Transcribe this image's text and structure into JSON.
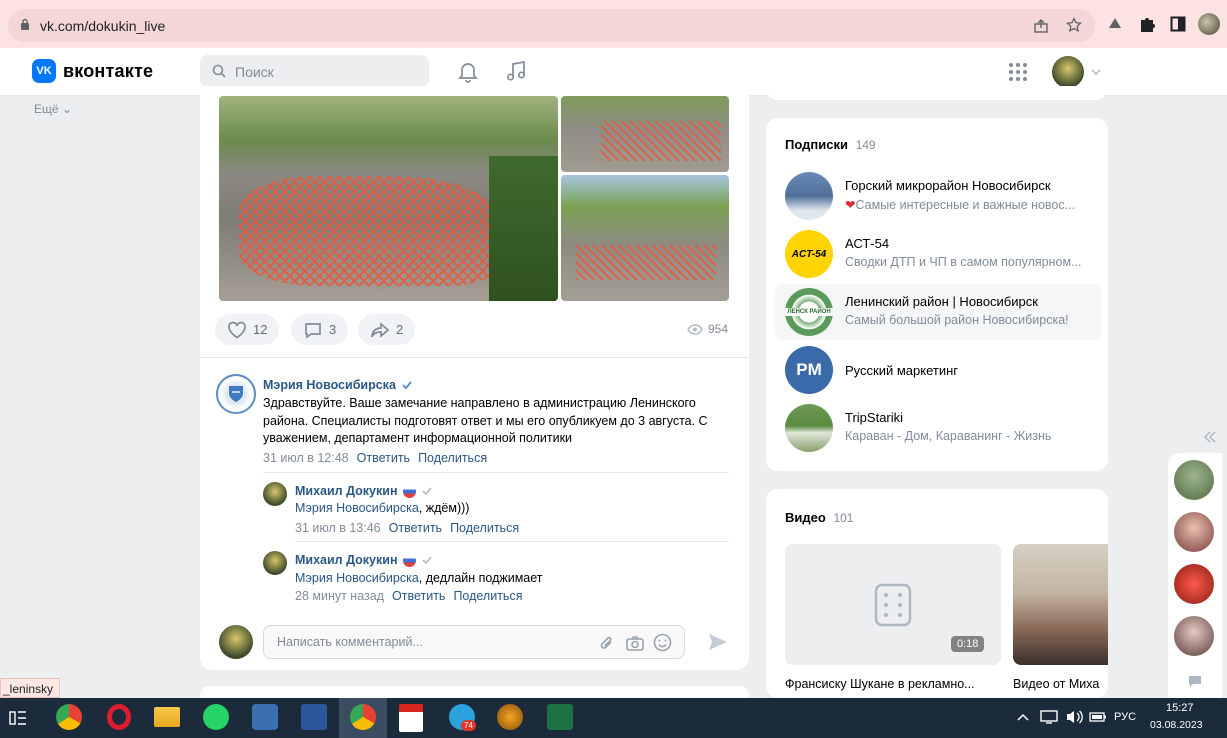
{
  "browser": {
    "url": "vk.com/dokukin_live"
  },
  "header": {
    "logo_text": "вконтакте",
    "search_placeholder": "Поиск"
  },
  "left_menu": {
    "more": "Ещё ⌄"
  },
  "post": {
    "likes": "12",
    "comments": "3",
    "shares": "2",
    "views": "954"
  },
  "comments": [
    {
      "author": "Мэрия Новосибирска",
      "text": "Здравствуйте. Ваше замечание направлено в администрацию Ленинского района. Специалисты подготовят ответ и мы его опубликуем до 3 августа. С уважением, департамент информационной политики",
      "time": "31 июл в 12:48",
      "reply": "Ответить",
      "share": "Поделиться"
    },
    {
      "author": "Михаил Докукин",
      "mention": "Мэрия Новосибирска",
      "text": ", ждём)))",
      "time": "31 июл в 13:46",
      "reply": "Ответить",
      "share": "Поделиться"
    },
    {
      "author": "Михаил Докукин",
      "mention": "Мэрия Новосибирска",
      "text": ", дедлайн поджимает",
      "time": "28 минут назад",
      "reply": "Ответить",
      "share": "Поделиться"
    }
  ],
  "comment_input": {
    "placeholder": "Написать комментарий..."
  },
  "subscriptions": {
    "title": "Подписки",
    "count": "149",
    "items": [
      {
        "name": "Горский микрорайон Новосибирск",
        "desc": "Самые интересные и важные новос..."
      },
      {
        "name": "АСТ-54",
        "desc": "Сводки ДТП и ЧП в самом популярном..."
      },
      {
        "name": "Ленинский район | Новосибирск",
        "desc": "Самый большой район Новосибирска!"
      },
      {
        "name": "Русский маркетинг",
        "desc": ""
      },
      {
        "name": "TripStariki",
        "desc": "Караван - Дом, Караванинг - Жизнь"
      }
    ],
    "avatar_texts": {
      "act": "ACT-54",
      "pm": "PM",
      "lenin": "ЛЕНСК РАЙОН"
    }
  },
  "videos": {
    "title": "Видео",
    "count": "101",
    "items": [
      {
        "title": "Франсиску Шукане в рекламно...",
        "duration": "0:18"
      },
      {
        "title": "Видео от Миха"
      }
    ]
  },
  "status_link": "_leninsky",
  "taskbar": {
    "lang": "РУС",
    "time": "15:27",
    "date": "03.08.2023",
    "telegram_badge": "74"
  },
  "colors": {
    "vk_blue": "#0077ff",
    "link": "#2a5885",
    "muted": "#818c99"
  }
}
